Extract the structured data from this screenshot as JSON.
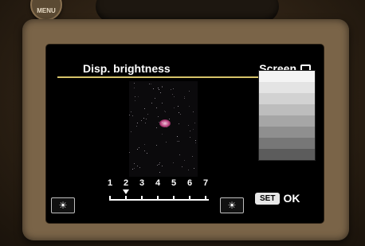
{
  "camera": {
    "menu_label": "MENU"
  },
  "screen": {
    "title": "Disp. brightness",
    "right_label": "Screen",
    "scale": {
      "numbers": [
        "1",
        "2",
        "3",
        "4",
        "5",
        "6",
        "7"
      ],
      "selected": 2
    },
    "footer": {
      "set_label": "SET",
      "ok_label": "OK"
    },
    "colors": {
      "accent_line": "#d6c36a",
      "background": "#000000",
      "gray_steps": [
        "#f4f4f4",
        "#e4e4e4",
        "#d2d2d2",
        "#bdbdbd",
        "#a6a6a6",
        "#8f8f8f",
        "#777777",
        "#5c5c5c"
      ]
    },
    "icons": {
      "left": "sun-dim-icon",
      "right": "sun-bright-icon",
      "screen_label": "screen-icon"
    }
  }
}
